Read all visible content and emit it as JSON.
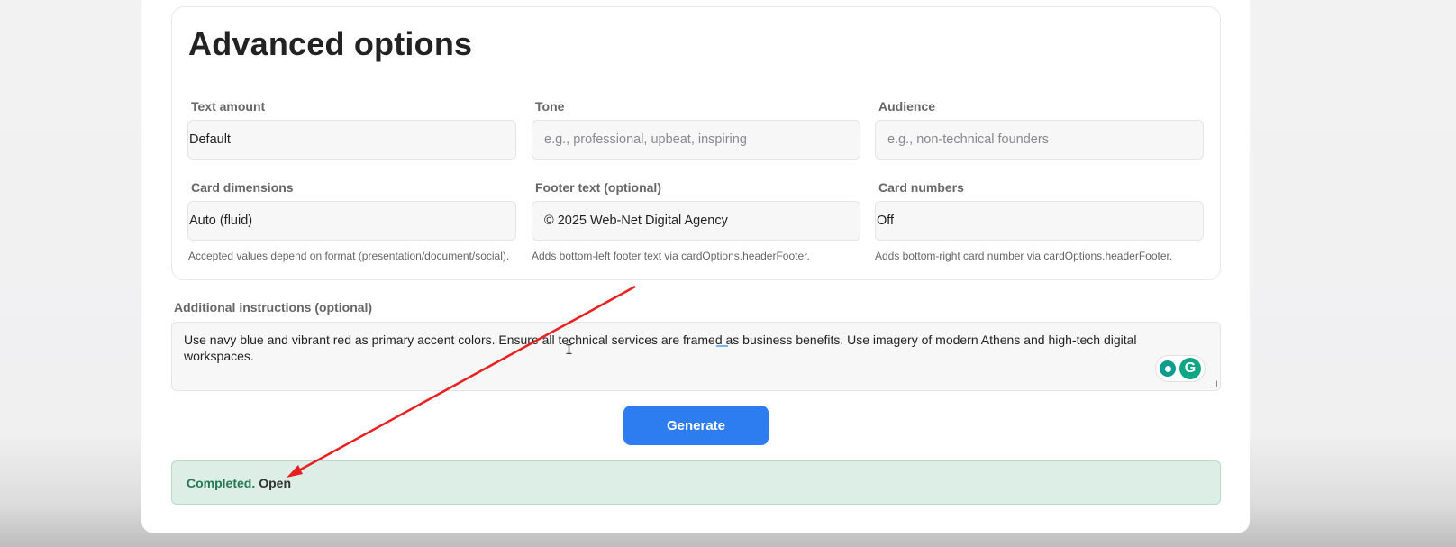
{
  "section": {
    "title": "Advanced options"
  },
  "fields": {
    "text_amount": {
      "label": "Text amount",
      "value": "Default"
    },
    "tone": {
      "label": "Tone",
      "placeholder": "e.g., professional, upbeat, inspiring"
    },
    "audience": {
      "label": "Audience",
      "placeholder": "e.g., non-technical founders"
    },
    "card_dimensions": {
      "label": "Card dimensions",
      "value": "Auto (fluid)",
      "hint": "Accepted values depend on format (presentation/document/social)."
    },
    "footer_text": {
      "label": "Footer text (optional)",
      "value": "© 2025 Web-Net Digital Agency",
      "hint": "Adds bottom-left footer text via cardOptions.headerFooter."
    },
    "card_numbers": {
      "label": "Card numbers",
      "value": "Off",
      "hint": "Adds bottom-right card number via cardOptions.headerFooter."
    }
  },
  "instructions": {
    "label": "Additional instructions (optional)",
    "value": "Use navy blue and vibrant red as primary accent colors. Ensure all technical services are framed as business benefits. Use imagery of modern Athens and high-tech digital workspaces."
  },
  "extension": {
    "icons": [
      "bulb-icon",
      "grammarly-icon"
    ],
    "letter": "G"
  },
  "generate_label": "Generate",
  "status": {
    "text": "Completed.",
    "link": "Open"
  },
  "annotation": {
    "color": "#e8201f"
  },
  "colors": {
    "accent": "#2e7df0",
    "success_bg": "#ddeee6",
    "success_text": "#257a52"
  }
}
